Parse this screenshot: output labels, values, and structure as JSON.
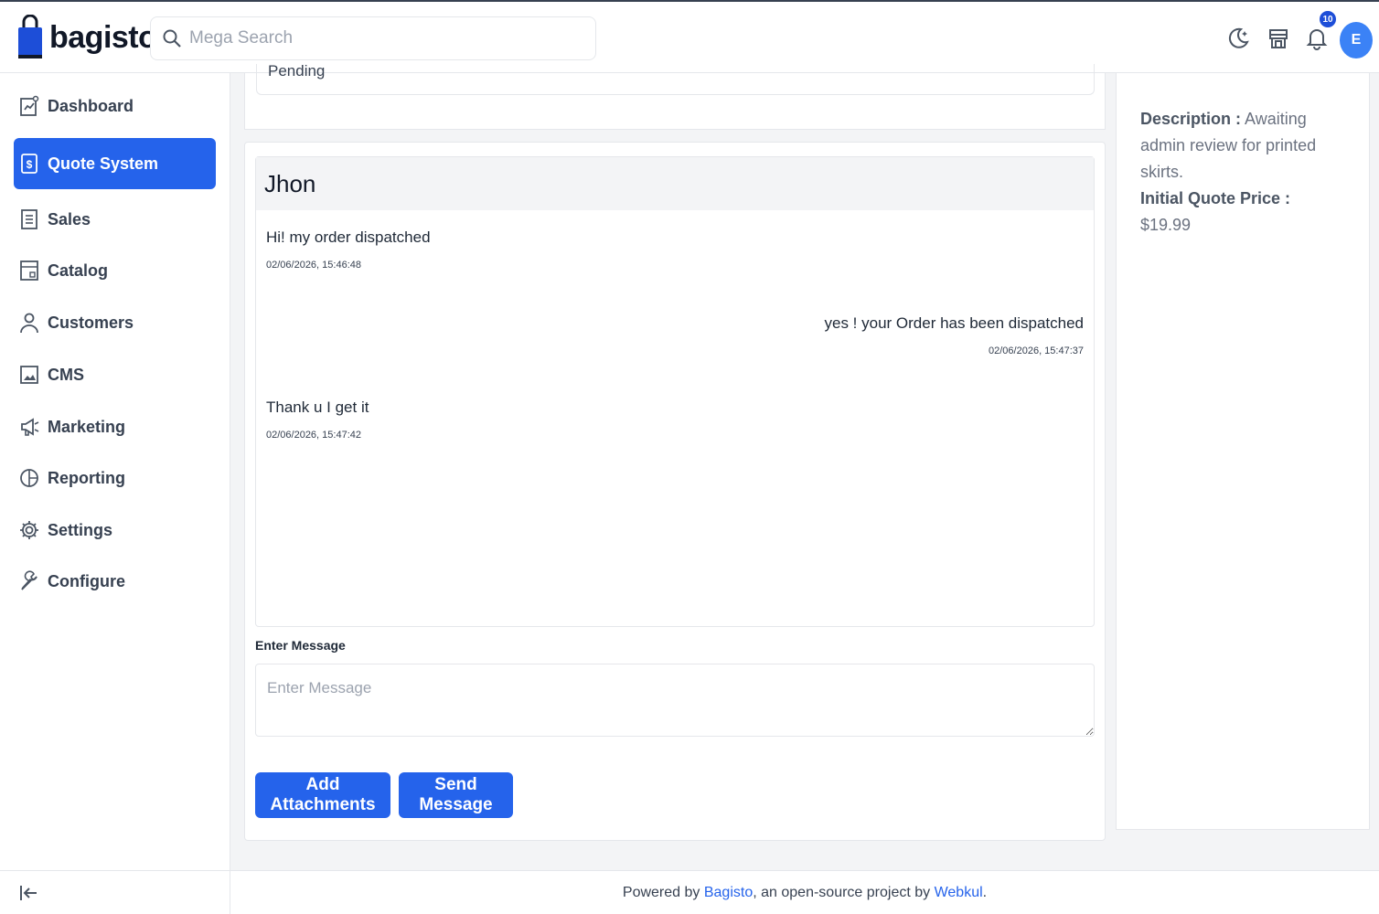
{
  "brand": {
    "name": "bagisto"
  },
  "search": {
    "placeholder": "Mega Search"
  },
  "header": {
    "notification_count": "10",
    "avatar_initial": "E",
    "icons": [
      "moon-icon",
      "store-icon",
      "bell-icon"
    ]
  },
  "sidebar": {
    "items": [
      {
        "label": "Dashboard",
        "icon": "dashboard-icon",
        "active": false
      },
      {
        "label": "Quote System",
        "icon": "quote-icon",
        "active": true
      },
      {
        "label": "Sales",
        "icon": "sales-icon",
        "active": false
      },
      {
        "label": "Catalog",
        "icon": "catalog-icon",
        "active": false
      },
      {
        "label": "Customers",
        "icon": "customers-icon",
        "active": false
      },
      {
        "label": "CMS",
        "icon": "cms-icon",
        "active": false
      },
      {
        "label": "Marketing",
        "icon": "marketing-icon",
        "active": false
      },
      {
        "label": "Reporting",
        "icon": "reporting-icon",
        "active": false
      },
      {
        "label": "Settings",
        "icon": "settings-icon",
        "active": false
      },
      {
        "label": "Configure",
        "icon": "configure-icon",
        "active": false
      }
    ]
  },
  "status": {
    "value": "Pending"
  },
  "chat": {
    "title": "Jhon",
    "messages": [
      {
        "text": "Hi! my order dispatched",
        "time": "02/06/2026, 15:46:48",
        "side": "left"
      },
      {
        "text": "yes ! your Order has been dispatched",
        "time": "02/06/2026, 15:47:37",
        "side": "right"
      },
      {
        "text": "Thank u I get it",
        "time": "02/06/2026, 15:47:42",
        "side": "left"
      }
    ],
    "input_label": "Enter Message",
    "input_placeholder": "Enter Message",
    "add_attachments_label": "Add Attachments",
    "send_label": "Send Message"
  },
  "info": {
    "description_label": "Description :",
    "description_value": "Awaiting admin review for printed skirts.",
    "price_label": "Initial Quote Price :",
    "price_value": "$19.99"
  },
  "footer": {
    "prefix": "Powered by ",
    "link1": "Bagisto",
    "middle": ", an open-source project by ",
    "link2": "Webkul",
    "suffix": "."
  },
  "colors": {
    "accent": "#2563eb",
    "badge": "#1d4ed8",
    "avatar": "#3b82f6"
  }
}
